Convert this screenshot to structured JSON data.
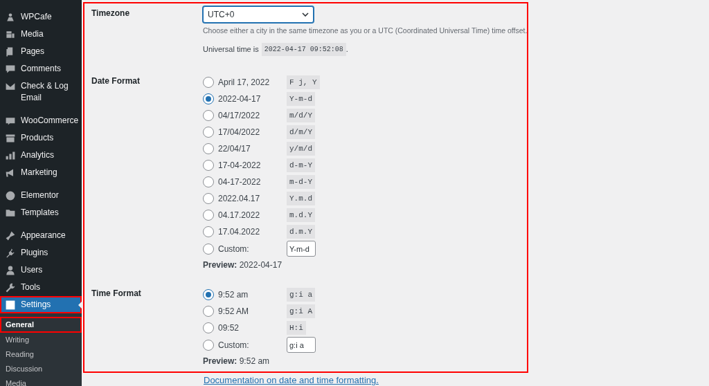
{
  "sidebar": {
    "items": [
      {
        "label": "WPCafe",
        "selected": false,
        "highlighted": false
      },
      {
        "label": "Media",
        "selected": false,
        "highlighted": false
      },
      {
        "label": "Pages",
        "selected": false,
        "highlighted": false
      },
      {
        "label": "Comments",
        "selected": false,
        "highlighted": false
      },
      {
        "label": "Check & Log Email",
        "selected": false,
        "highlighted": false,
        "gap_after": true
      },
      {
        "label": "WooCommerce",
        "selected": false,
        "highlighted": false
      },
      {
        "label": "Products",
        "selected": false,
        "highlighted": false
      },
      {
        "label": "Analytics",
        "selected": false,
        "highlighted": false
      },
      {
        "label": "Marketing",
        "selected": false,
        "highlighted": false,
        "gap_after": true
      },
      {
        "label": "Elementor",
        "selected": false,
        "highlighted": false
      },
      {
        "label": "Templates",
        "selected": false,
        "highlighted": false,
        "gap_after": true
      },
      {
        "label": "Appearance",
        "selected": false,
        "highlighted": false
      },
      {
        "label": "Plugins",
        "selected": false,
        "highlighted": false
      },
      {
        "label": "Users",
        "selected": false,
        "highlighted": false
      },
      {
        "label": "Tools",
        "selected": false,
        "highlighted": false
      },
      {
        "label": "Settings",
        "selected": true,
        "highlighted": true
      }
    ],
    "submenu": [
      {
        "label": "General",
        "selected": true,
        "highlighted": true
      },
      {
        "label": "Writing",
        "selected": false,
        "highlighted": false
      },
      {
        "label": "Reading",
        "selected": false,
        "highlighted": false
      },
      {
        "label": "Discussion",
        "selected": false,
        "highlighted": false
      },
      {
        "label": "Media",
        "selected": false,
        "highlighted": false
      }
    ]
  },
  "form": {
    "highlighted": true,
    "timezone": {
      "label": "Timezone",
      "value": "UTC+0",
      "description": "Choose either a city in the same timezone as you or a UTC (Coordinated Universal Time) time offset.",
      "universal_label": "Universal time is",
      "universal_time": "2022-04-17 09:52:08",
      "universal_end": "."
    },
    "date_format": {
      "label": "Date Format",
      "options": [
        {
          "label": "April 17, 2022",
          "code": "F j, Y",
          "selected": false
        },
        {
          "label": "2022-04-17",
          "code": "Y-m-d",
          "selected": true
        },
        {
          "label": "04/17/2022",
          "code": "m/d/Y",
          "selected": false
        },
        {
          "label": "17/04/2022",
          "code": "d/m/Y",
          "selected": false
        },
        {
          "label": "22/04/17",
          "code": "y/m/d",
          "selected": false
        },
        {
          "label": "17-04-2022",
          "code": "d-m-Y",
          "selected": false
        },
        {
          "label": "04-17-2022",
          "code": "m-d-Y",
          "selected": false
        },
        {
          "label": "2022.04.17",
          "code": "Y.m.d",
          "selected": false
        },
        {
          "label": "04.17.2022",
          "code": "m.d.Y",
          "selected": false
        },
        {
          "label": "17.04.2022",
          "code": "d.m.Y",
          "selected": false
        }
      ],
      "custom": {
        "label": "Custom:",
        "value": "Y-m-d",
        "selected": false
      },
      "preview": "**Preview:** 2022-04-17"
    },
    "time_format": {
      "label": "Time Format",
      "options": [
        {
          "label": "9:52 am",
          "code": "g:i a",
          "selected": true
        },
        {
          "label": "9:52 AM",
          "code": "g:i A",
          "selected": false
        },
        {
          "label": "09:52",
          "code": "H:i",
          "selected": false
        }
      ],
      "custom": {
        "label": "Custom:",
        "value": "g:i a",
        "selected": false
      },
      "preview": "**Preview:** 9:52 am"
    }
  },
  "documentation_link": "Documentation on date and time formatting."
}
